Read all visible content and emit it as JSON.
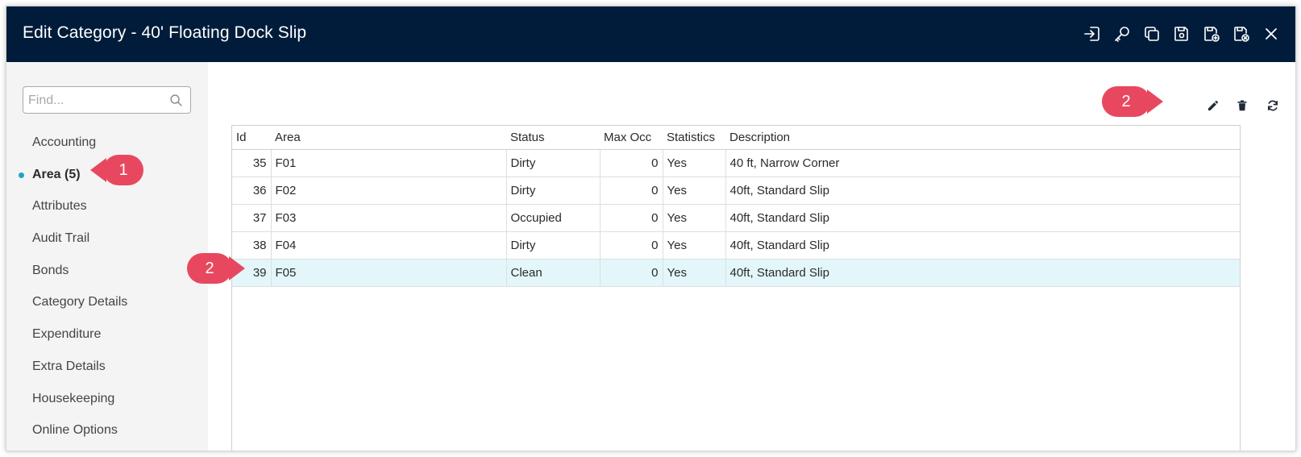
{
  "window": {
    "title": "Edit Category - 40' Floating Dock Slip",
    "actions": [
      {
        "name": "login-icon",
        "label": "Sign in"
      },
      {
        "name": "key-icon",
        "label": "Key"
      },
      {
        "name": "copy-icon",
        "label": "Copy"
      },
      {
        "name": "save-icon",
        "label": "Save"
      },
      {
        "name": "save-and-new-icon",
        "label": "Save and new"
      },
      {
        "name": "save-and-close-icon",
        "label": "Save and close"
      },
      {
        "name": "close-icon",
        "label": "Close"
      }
    ]
  },
  "sidebar": {
    "search_placeholder": "Find...",
    "items": [
      {
        "label": "Accounting",
        "active": false
      },
      {
        "label": "Area (5)",
        "active": true
      },
      {
        "label": "Attributes",
        "active": false
      },
      {
        "label": "Audit Trail",
        "active": false
      },
      {
        "label": "Bonds",
        "active": false
      },
      {
        "label": "Category Details",
        "active": false
      },
      {
        "label": "Expenditure",
        "active": false
      },
      {
        "label": "Extra Details",
        "active": false
      },
      {
        "label": "Housekeeping",
        "active": false
      },
      {
        "label": "Online Options",
        "active": false
      }
    ]
  },
  "toolbar": {
    "icons": [
      "add-grid-icon",
      "edit-pencil-icon",
      "delete-trash-icon",
      "refresh-icon"
    ]
  },
  "grid": {
    "columns": [
      "Id",
      "Area",
      "Status",
      "Max Occ",
      "Statistics",
      "Description"
    ],
    "rows": [
      {
        "id": "35",
        "area": "F01",
        "status": "Dirty",
        "max_occ": "0",
        "statistics": "Yes",
        "description": "40 ft, Narrow Corner",
        "selected": false
      },
      {
        "id": "36",
        "area": "F02",
        "status": "Dirty",
        "max_occ": "0",
        "statistics": "Yes",
        "description": "40ft, Standard Slip",
        "selected": false
      },
      {
        "id": "37",
        "area": "F03",
        "status": "Occupied",
        "max_occ": "0",
        "statistics": "Yes",
        "description": "40ft, Standard Slip",
        "selected": false
      },
      {
        "id": "38",
        "area": "F04",
        "status": "Dirty",
        "max_occ": "0",
        "statistics": "Yes",
        "description": "40ft, Standard Slip",
        "selected": false
      },
      {
        "id": "39",
        "area": "F05",
        "status": "Clean",
        "max_occ": "0",
        "statistics": "Yes",
        "description": "40ft, Standard Slip",
        "selected": true
      }
    ]
  },
  "callouts": {
    "sidebar_step": "1",
    "toolbar_step": "2",
    "row_step": "2"
  },
  "colors": {
    "titlebar": "#001c3a",
    "accent_dot": "#19a7c6",
    "selected_row": "#e3f7fb",
    "callout": "#e8485f"
  }
}
